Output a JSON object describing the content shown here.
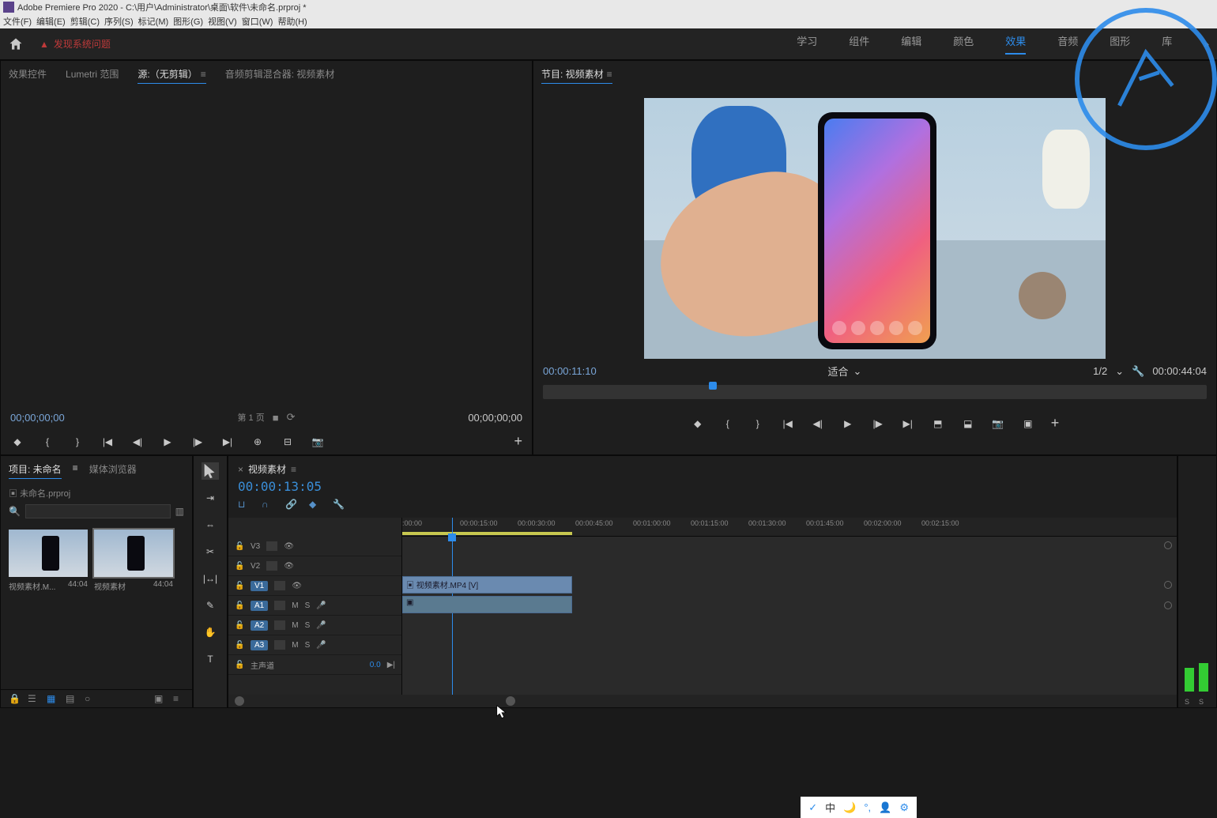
{
  "app": {
    "title": "Adobe Premiere Pro 2020 - C:\\用户\\Administrator\\桌面\\软件\\未命名.prproj *"
  },
  "menu": [
    "文件(F)",
    "编辑(E)",
    "剪辑(C)",
    "序列(S)",
    "标记(M)",
    "图形(G)",
    "视图(V)",
    "窗口(W)",
    "帮助(H)"
  ],
  "warning": "发现系统问题",
  "workspaces": {
    "items": [
      "学习",
      "组件",
      "编辑",
      "颜色",
      "效果",
      "音频",
      "图形",
      "库"
    ],
    "active": "效果"
  },
  "source_panel": {
    "tabs": [
      "效果控件",
      "Lumetri 范围",
      "源:（无剪辑）",
      "音频剪辑混合器: 视频素材"
    ],
    "active_tab": "源:（无剪辑）",
    "tc_left": "00;00;00;00",
    "tc_right": "00;00;00;00",
    "page": "第 1 页"
  },
  "program_panel": {
    "tab": "节目: 视频素材",
    "tc_left": "00:00:11:10",
    "tc_right": "00:00:44:04",
    "fit": "适合",
    "res": "1/2"
  },
  "project_panel": {
    "tabs": [
      "项目: 未命名",
      "媒体浏览器"
    ],
    "active_tab": "项目: 未命名",
    "project_name": "未命名.prproj",
    "search_placeholder": "",
    "bins": [
      {
        "name": "视频素材.M...",
        "dur": "44:04"
      },
      {
        "name": "视频素材",
        "dur": "44:04"
      }
    ]
  },
  "timeline": {
    "seq_name": "视频素材",
    "tc": "00:00:13:05",
    "ruler": [
      ":00:00",
      "00:00:15:00",
      "00:00:30:00",
      "00:00:45:00",
      "00:01:00:00",
      "00:01:15:00",
      "00:01:30:00",
      "00:01:45:00",
      "00:02:00:00",
      "00:02:15:00"
    ],
    "tracks": {
      "video": [
        "V3",
        "V2",
        "V1"
      ],
      "audio": [
        "A1",
        "A2",
        "A3"
      ],
      "master": "主声道",
      "master_val": "0.0"
    },
    "clip_name": "视频素材.MP4 [V]",
    "mute": "M",
    "solo": "S"
  },
  "ime": "中",
  "meter_labels": [
    "S",
    "S"
  ]
}
